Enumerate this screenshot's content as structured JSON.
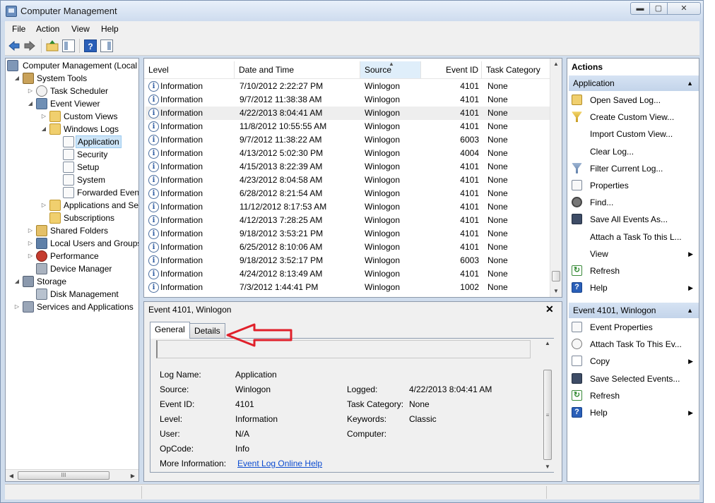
{
  "window": {
    "title": "Computer Management",
    "controls": {
      "minimize": "▬",
      "maximize": "▢",
      "close": "✕"
    }
  },
  "menu": {
    "file": "File",
    "action": "Action",
    "view": "View",
    "help": "Help"
  },
  "toolbar": {
    "help_glyph": "?"
  },
  "tree": {
    "items": [
      {
        "label": "Computer Management (Local",
        "icon": "computer-icon"
      },
      {
        "label": "System Tools",
        "icon": "tools-icon"
      },
      {
        "label": "Task Scheduler",
        "icon": "clock-icon"
      },
      {
        "label": "Event Viewer",
        "icon": "event-viewer-icon"
      },
      {
        "label": "Custom Views",
        "icon": "folder-icon"
      },
      {
        "label": "Windows Logs",
        "icon": "folder-icon"
      },
      {
        "label": "Application",
        "icon": "log-icon"
      },
      {
        "label": "Security",
        "icon": "log-icon"
      },
      {
        "label": "Setup",
        "icon": "log-icon"
      },
      {
        "label": "System",
        "icon": "log-icon"
      },
      {
        "label": "Forwarded Event",
        "icon": "log-icon"
      },
      {
        "label": "Applications and Se",
        "icon": "folder-icon"
      },
      {
        "label": "Subscriptions",
        "icon": "subscriptions-icon"
      },
      {
        "label": "Shared Folders",
        "icon": "shared-folder-icon"
      },
      {
        "label": "Local Users and Groups",
        "icon": "users-icon"
      },
      {
        "label": "Performance",
        "icon": "performance-icon"
      },
      {
        "label": "Device Manager",
        "icon": "device-manager-icon"
      },
      {
        "label": "Storage",
        "icon": "storage-icon"
      },
      {
        "label": "Disk Management",
        "icon": "disk-icon"
      },
      {
        "label": "Services and Applications",
        "icon": "services-icon"
      }
    ],
    "scroll_thumb_grip": "III"
  },
  "events": {
    "columns": {
      "level": "Level",
      "date": "Date and Time",
      "source": "Source",
      "event_id": "Event ID",
      "task_category": "Task Category"
    },
    "rows": [
      {
        "level": "Information",
        "date": "7/10/2012 2:22:27 PM",
        "source": "Winlogon",
        "id": "4101",
        "task": "None"
      },
      {
        "level": "Information",
        "date": "9/7/2012 11:38:38 AM",
        "source": "Winlogon",
        "id": "4101",
        "task": "None"
      },
      {
        "level": "Information",
        "date": "4/22/2013 8:04:41 AM",
        "source": "Winlogon",
        "id": "4101",
        "task": "None"
      },
      {
        "level": "Information",
        "date": "11/8/2012 10:55:55 AM",
        "source": "Winlogon",
        "id": "4101",
        "task": "None"
      },
      {
        "level": "Information",
        "date": "9/7/2012 11:38:22 AM",
        "source": "Winlogon",
        "id": "6003",
        "task": "None"
      },
      {
        "level": "Information",
        "date": "4/13/2012 5:02:30 PM",
        "source": "Winlogon",
        "id": "4004",
        "task": "None"
      },
      {
        "level": "Information",
        "date": "4/15/2013 8:22:39 AM",
        "source": "Winlogon",
        "id": "4101",
        "task": "None"
      },
      {
        "level": "Information",
        "date": "4/23/2012 8:04:58 AM",
        "source": "Winlogon",
        "id": "4101",
        "task": "None"
      },
      {
        "level": "Information",
        "date": "6/28/2012 8:21:54 AM",
        "source": "Winlogon",
        "id": "4101",
        "task": "None"
      },
      {
        "level": "Information",
        "date": "11/12/2012 8:17:53 AM",
        "source": "Winlogon",
        "id": "4101",
        "task": "None"
      },
      {
        "level": "Information",
        "date": "4/12/2013 7:28:25 AM",
        "source": "Winlogon",
        "id": "4101",
        "task": "None"
      },
      {
        "level": "Information",
        "date": "9/18/2012 3:53:21 PM",
        "source": "Winlogon",
        "id": "4101",
        "task": "None"
      },
      {
        "level": "Information",
        "date": "6/25/2012 8:10:06 AM",
        "source": "Winlogon",
        "id": "4101",
        "task": "None"
      },
      {
        "level": "Information",
        "date": "9/18/2012 3:52:17 PM",
        "source": "Winlogon",
        "id": "6003",
        "task": "None"
      },
      {
        "level": "Information",
        "date": "4/24/2012 8:13:49 AM",
        "source": "Winlogon",
        "id": "4101",
        "task": "None"
      },
      {
        "level": "Information",
        "date": "7/3/2012 1:44:41 PM",
        "source": "Winlogon",
        "id": "1002",
        "task": "None"
      }
    ],
    "info_glyph": "i"
  },
  "detail": {
    "title": "Event 4101, Winlogon",
    "close_glyph": "✕",
    "tabs": {
      "general": "General",
      "details": "Details"
    },
    "fields": {
      "log_name_label": "Log Name:",
      "log_name": "Application",
      "source_label": "Source:",
      "source": "Winlogon",
      "logged_label": "Logged:",
      "logged": "4/22/2013 8:04:41 AM",
      "event_id_label": "Event ID:",
      "event_id": "4101",
      "task_category_label": "Task Category:",
      "task_category": "None",
      "level_label": "Level:",
      "level": "Information",
      "keywords_label": "Keywords:",
      "keywords": "Classic",
      "user_label": "User:",
      "user": "N/A",
      "computer_label": "Computer:",
      "computer": "",
      "opcode_label": "OpCode:",
      "opcode": "Info",
      "more_info_label": "More Information:",
      "more_info_link": "Event Log Online Help"
    },
    "scroll_thumb_grip": "≡"
  },
  "actions": {
    "title": "Actions",
    "section1": "Application",
    "section1_items": [
      {
        "label": "Open Saved Log...",
        "icon": "open-log-icon"
      },
      {
        "label": "Create Custom View...",
        "icon": "filter-icon"
      },
      {
        "label": "Import Custom View...",
        "icon": ""
      },
      {
        "label": "Clear Log...",
        "icon": ""
      },
      {
        "label": "Filter Current Log...",
        "icon": "filter-icon"
      },
      {
        "label": "Properties",
        "icon": "properties-icon"
      },
      {
        "label": "Find...",
        "icon": "find-icon"
      },
      {
        "label": "Save All Events As...",
        "icon": "save-icon"
      },
      {
        "label": "Attach a Task To this L...",
        "icon": ""
      },
      {
        "label": "View",
        "icon": ""
      },
      {
        "label": "Refresh",
        "icon": "refresh-icon"
      },
      {
        "label": "Help",
        "icon": "help-icon"
      }
    ],
    "section2": "Event 4101, Winlogon",
    "section2_items": [
      {
        "label": "Event Properties",
        "icon": "properties-icon"
      },
      {
        "label": "Attach Task To This Ev...",
        "icon": "clock-icon"
      },
      {
        "label": "Copy",
        "icon": "copy-icon"
      },
      {
        "label": "Save Selected Events...",
        "icon": "save-icon"
      },
      {
        "label": "Refresh",
        "icon": "refresh-icon"
      },
      {
        "label": "Help",
        "icon": "help-icon"
      }
    ],
    "collapse_glyph": "▲",
    "submenu_glyph": "▶",
    "refresh_glyph": "↻",
    "help_glyph": "?"
  },
  "colors": {
    "annotation_arrow": "#e0202a",
    "selection": "#cce4f7",
    "section_header": "#c9d8ec",
    "link": "#0b4bd0"
  }
}
